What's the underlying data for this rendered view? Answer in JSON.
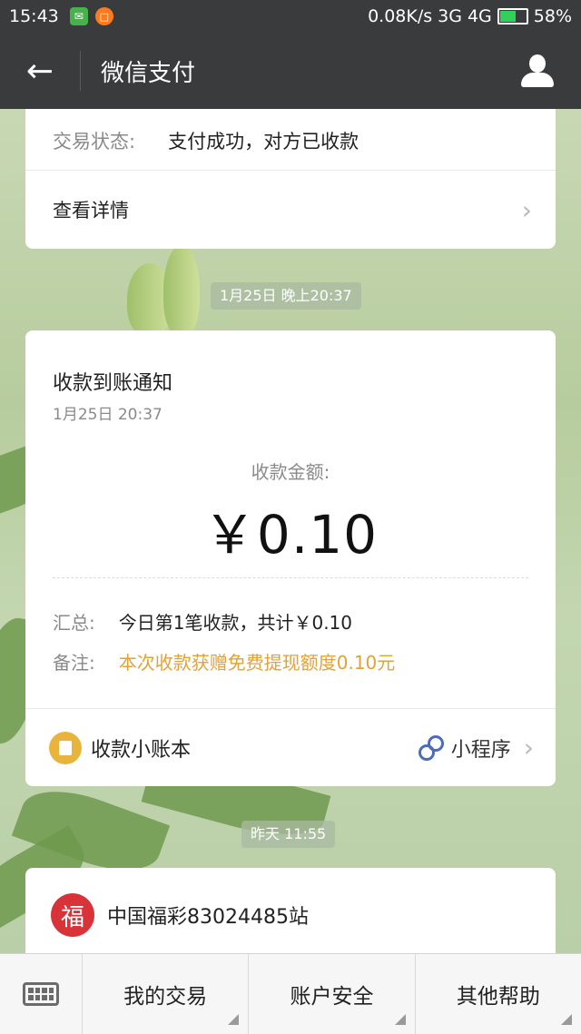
{
  "status_bar": {
    "time": "15:43",
    "network": "0.08K/s",
    "signal1": "3G",
    "signal2": "4G",
    "battery": "58%"
  },
  "header": {
    "back_icon": "arrow-left-icon",
    "title": "微信支付",
    "profile_icon": "person-icon"
  },
  "card_transaction": {
    "status_label": "交易状态:",
    "status_value": "支付成功，对方已收款",
    "details_label": "查看详情"
  },
  "timestamps": {
    "t1": "1月25日 晚上20:37",
    "t2": "昨天 11:55"
  },
  "card_receipt": {
    "title": "收款到账通知",
    "time": "1月25日  20:37",
    "amount_label": "收款金额:",
    "amount": "￥0.10",
    "summary_label": "汇总:",
    "summary_value": "今日第1笔收款，共计￥0.10",
    "note_label": "备注:",
    "note_value": "本次收款获赠免费提现额度0.10元",
    "ledger_label": "收款小账本",
    "mini_program_label": "小程序",
    "colors": {
      "note": "#e3a13a",
      "ledger_icon": "#e8b43c",
      "mini_icon": "#4d6cb8"
    }
  },
  "card_lottery": {
    "icon_char": "福",
    "name": "中国福彩83024485站"
  },
  "bottom_menu": {
    "items": [
      "我的交易",
      "账户安全",
      "其他帮助"
    ]
  }
}
